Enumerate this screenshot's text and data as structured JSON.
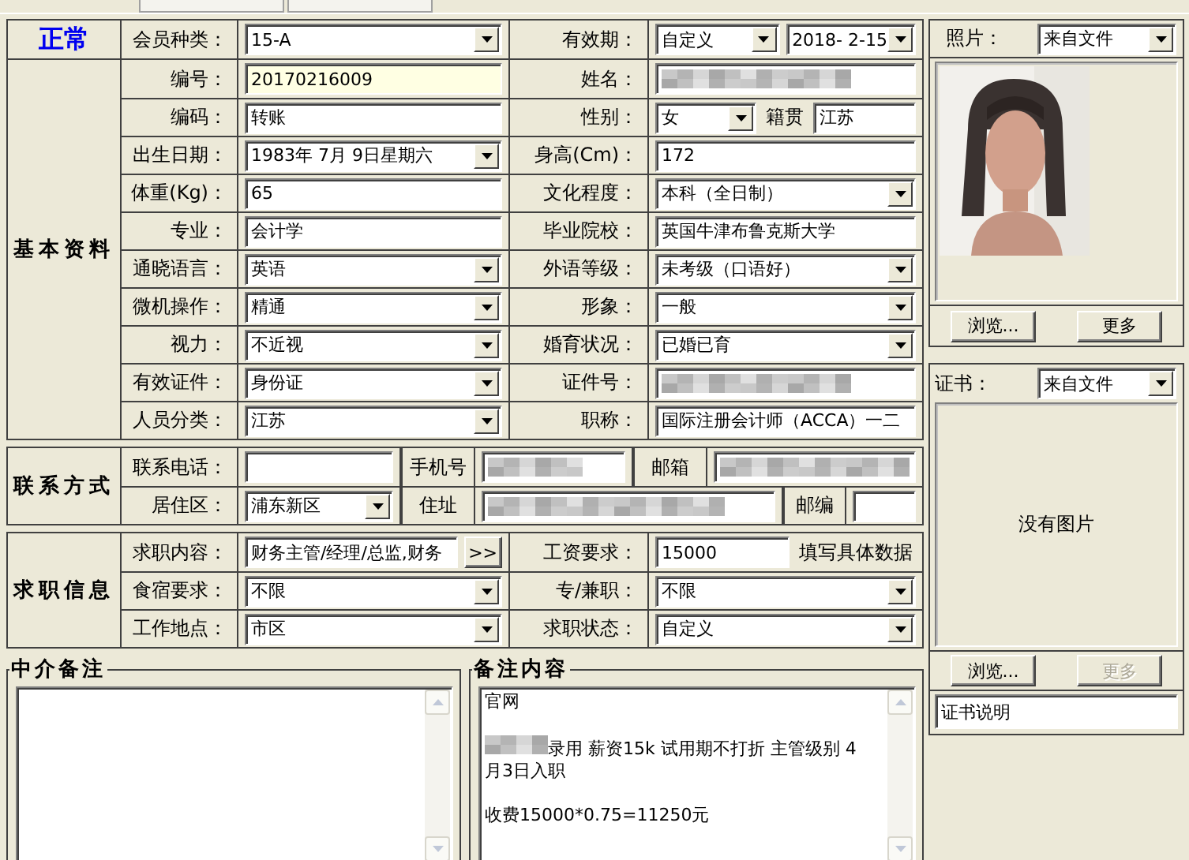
{
  "sections": [
    {
      "kind": "status",
      "title": "正常",
      "rows": [
        {
          "pairs": [
            {
              "label": "会员种类：",
              "controls": [
                {
                  "kind": "combo",
                  "value": "15-A"
                }
              ]
            },
            {
              "label": "有效期：",
              "controls": [
                {
                  "kind": "combo",
                  "value": "自定义"
                },
                {
                  "kind": "combo",
                  "value": "2018- 2-15"
                }
              ]
            }
          ]
        }
      ]
    },
    {
      "kind": "group",
      "title": "基本资料",
      "rows": [
        {
          "pairs": [
            {
              "label": "编号：",
              "controls": [
                {
                  "kind": "text",
                  "value": "20170216009",
                  "focused": true
                }
              ]
            },
            {
              "label": "姓名：",
              "controls": [
                {
                  "kind": "redacted"
                }
              ]
            }
          ]
        },
        {
          "pairs": [
            {
              "label": "编码：",
              "controls": [
                {
                  "kind": "text",
                  "value": "转账",
                  "focused": false
                }
              ]
            },
            {
              "label": "性别：",
              "controls": [
                {
                  "kind": "combo",
                  "value": "女"
                },
                {
                  "kind": "label",
                  "value": "籍贯"
                },
                {
                  "kind": "text",
                  "value": "江苏",
                  "focused": false
                }
              ]
            }
          ]
        },
        {
          "pairs": [
            {
              "label": "出生日期：",
              "controls": [
                {
                  "kind": "combo",
                  "value": "1983年 7月 9日星期六"
                }
              ]
            },
            {
              "label": "身高(Cm)：",
              "controls": [
                {
                  "kind": "text",
                  "value": "172",
                  "focused": false
                }
              ]
            }
          ]
        },
        {
          "pairs": [
            {
              "label": "体重(Kg)：",
              "controls": [
                {
                  "kind": "text",
                  "value": "65",
                  "focused": false
                }
              ]
            },
            {
              "label": "文化程度：",
              "controls": [
                {
                  "kind": "combo",
                  "value": "本科（全日制）"
                }
              ]
            }
          ]
        },
        {
          "pairs": [
            {
              "label": "专业：",
              "controls": [
                {
                  "kind": "text",
                  "value": "会计学",
                  "focused": false
                }
              ]
            },
            {
              "label": "毕业院校：",
              "controls": [
                {
                  "kind": "text",
                  "value": "英国牛津布鲁克斯大学",
                  "focused": false
                }
              ]
            }
          ]
        },
        {
          "pairs": [
            {
              "label": "通晓语言：",
              "controls": [
                {
                  "kind": "combo",
                  "value": "英语"
                }
              ]
            },
            {
              "label": "外语等级：",
              "controls": [
                {
                  "kind": "combo",
                  "value": "未考级（口语好）"
                }
              ]
            }
          ]
        },
        {
          "pairs": [
            {
              "label": "微机操作：",
              "controls": [
                {
                  "kind": "combo",
                  "value": "精通"
                }
              ]
            },
            {
              "label": "形象：",
              "controls": [
                {
                  "kind": "combo",
                  "value": "一般"
                }
              ]
            }
          ]
        },
        {
          "pairs": [
            {
              "label": "视力：",
              "controls": [
                {
                  "kind": "combo",
                  "value": "不近视"
                }
              ]
            },
            {
              "label": "婚育状况：",
              "controls": [
                {
                  "kind": "combo",
                  "value": "已婚已育"
                }
              ]
            }
          ]
        },
        {
          "pairs": [
            {
              "label": "有效证件：",
              "controls": [
                {
                  "kind": "combo",
                  "value": "身份证"
                }
              ]
            },
            {
              "label": "证件号：",
              "controls": [
                {
                  "kind": "redacted"
                }
              ]
            }
          ]
        },
        {
          "pairs": [
            {
              "label": "人员分类：",
              "controls": [
                {
                  "kind": "combo",
                  "value": "江苏"
                }
              ]
            },
            {
              "label": "职称：",
              "controls": [
                {
                  "kind": "text",
                  "value": "国际注册会计师（ACCA）一二",
                  "focused": false
                }
              ]
            }
          ]
        }
      ]
    },
    {
      "kind": "group",
      "title": "联系方式",
      "rows": [
        {
          "pairs": [
            {
              "label": "联系电话：",
              "controls": [
                {
                  "kind": "text",
                  "focused": false
                }
              ]
            },
            {
              "label": "手机号",
              "controls": [
                {
                  "kind": "redacted"
                }
              ]
            },
            {
              "label": "邮箱",
              "controls": [
                {
                  "kind": "redacted"
                }
              ]
            }
          ]
        },
        {
          "pairs": [
            {
              "label": "居住区：",
              "controls": [
                {
                  "kind": "combo",
                  "value": "浦东新区"
                }
              ]
            },
            {
              "label": "住址",
              "controls": [
                {
                  "kind": "redacted"
                }
              ]
            },
            {
              "label": "邮编",
              "controls": [
                {
                  "kind": "text",
                  "focused": false
                }
              ]
            }
          ]
        }
      ]
    },
    {
      "kind": "group",
      "title": "求职信息",
      "rows": [
        {
          "pairs": [
            {
              "label": "求职内容：",
              "controls": [
                {
                  "kind": "text",
                  "value": "财务主管/经理/总监,财务",
                  "focused": false
                },
                {
                  "kind": "button",
                  "value": ">>"
                }
              ]
            },
            {
              "label": "工资要求：",
              "controls": [
                {
                  "kind": "text",
                  "value": "15000",
                  "focused": false
                },
                {
                  "kind": "label",
                  "value": "填写具体数据"
                }
              ]
            }
          ]
        },
        {
          "pairs": [
            {
              "label": "食宿要求：",
              "controls": [
                {
                  "kind": "combo",
                  "value": "不限"
                }
              ]
            },
            {
              "label": "专/兼职：",
              "controls": [
                {
                  "kind": "combo",
                  "value": "不限"
                }
              ]
            }
          ]
        },
        {
          "pairs": [
            {
              "label": "工作地点：",
              "controls": [
                {
                  "kind": "combo",
                  "value": "市区"
                }
              ]
            },
            {
              "label": "求职状态：",
              "controls": [
                {
                  "kind": "combo",
                  "value": "自定义"
                }
              ]
            }
          ]
        }
      ]
    }
  ],
  "notes": [
    {
      "title": "中介备注"
    },
    {
      "title": "备注内容",
      "paragraphs": [
        {
          "text": "官网",
          "redacted_prefix": false
        },
        {
          "text": "录用 薪资15k 试用期不打折 主管级别 4月3日入职",
          "redacted_prefix": true
        },
        {
          "text": "收费15000*0.75=11250元",
          "redacted_prefix": false
        }
      ]
    }
  ],
  "photo": {
    "label": "照片：",
    "source": "来自文件",
    "buttons": [
      {
        "label": "浏览...",
        "disabled": false
      },
      {
        "label": "更多",
        "disabled": false
      }
    ]
  },
  "certificate": {
    "label": "证书：",
    "source": "来自文件",
    "empty_text": "没有图片",
    "buttons": [
      {
        "label": "浏览...",
        "disabled": false
      },
      {
        "label": "更多",
        "disabled": true
      }
    ],
    "caption": "证书说明"
  }
}
